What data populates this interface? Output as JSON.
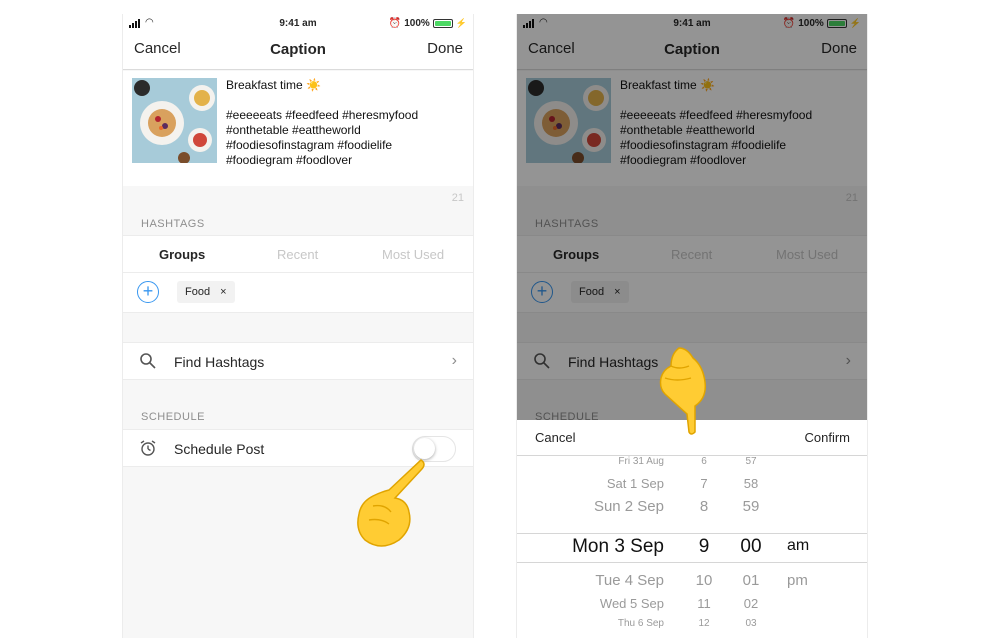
{
  "status_bar": {
    "time": "9:41 am",
    "battery": "100%"
  },
  "nav": {
    "cancel": "Cancel",
    "title": "Caption",
    "done": "Done"
  },
  "post": {
    "caption_title": "Breakfast time ☀️",
    "hashtag_lines": [
      "#eeeeeats #feedfeed #heresmyfood",
      "#onthetable #eattheworld",
      "#foodiesofinstagram #foodielife",
      "#foodiegram #foodlover"
    ],
    "count": "21"
  },
  "hashtags": {
    "section": "HASHTAGS",
    "tabs": [
      "Groups",
      "Recent",
      "Most Used"
    ],
    "chip": "Food",
    "chip_remove": "×",
    "find": "Find Hashtags"
  },
  "schedule": {
    "section": "SCHEDULE",
    "label": "Schedule Post",
    "toggle_on": false
  },
  "picker": {
    "cancel": "Cancel",
    "confirm": "Confirm",
    "dates": [
      "Fri 31 Aug",
      "Sat 1 Sep",
      "Sun 2 Sep",
      "Mon 3 Sep",
      "Tue 4 Sep",
      "Wed 5 Sep",
      "Thu 6 Sep"
    ],
    "hours": [
      "6",
      "7",
      "8",
      "9",
      "10",
      "11",
      "12"
    ],
    "minutes": [
      "57",
      "58",
      "59",
      "00",
      "01",
      "02",
      "03"
    ],
    "ampm": [
      "am",
      "pm"
    ]
  },
  "colors": {
    "accent": "#3897f0",
    "overlay": "#000000",
    "battery": "#4cd964"
  },
  "icons": [
    "signal-icon",
    "wifi-icon",
    "alarm-icon",
    "battery-icon",
    "plus-circle-icon",
    "search-icon",
    "chevron-right-icon",
    "alarm-clock-icon",
    "pointing-hand-icon"
  ]
}
